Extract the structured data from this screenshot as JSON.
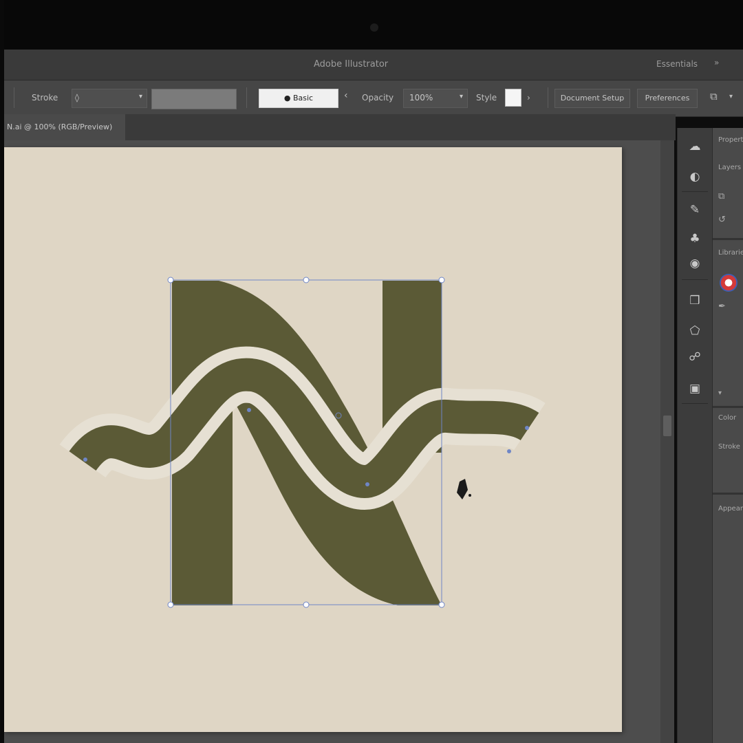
{
  "window": {
    "title": "Adobe Illustrator",
    "workspace": "Essentials",
    "workspace_chevron": "»"
  },
  "control_bar": {
    "stroke_label": "Stroke",
    "stroke_spinner": "◊",
    "dropdown_arrow": "▾",
    "basic_label": "● Basic",
    "opacity_label": "Opacity",
    "opacity_value": "100%",
    "style_label": "Style",
    "btn_document_setup": "Document Setup",
    "btn_preferences": "Preferences",
    "chevron_left": "‹",
    "chevron_right": "›"
  },
  "document_tab": {
    "label": "N.ai @ 100% (RGB/Preview)"
  },
  "artwork": {
    "fill_color": "#5b5a36",
    "band_color": "#e6e0d3",
    "artboard_color": "#dfd6c5",
    "selection_color": "#6f86c6"
  },
  "tools_column": {
    "icons": [
      "cloud-icon",
      "color-wheel-icon",
      "brush-icon",
      "symbol-icon",
      "swatch-icon",
      "layers-icon",
      "stroke-icon",
      "link-icon",
      "artboard-icon"
    ]
  },
  "right_panel": {
    "tabs": [
      "Properties",
      "Layers",
      "Libraries",
      "Color",
      "Stroke",
      "Appearance"
    ]
  }
}
